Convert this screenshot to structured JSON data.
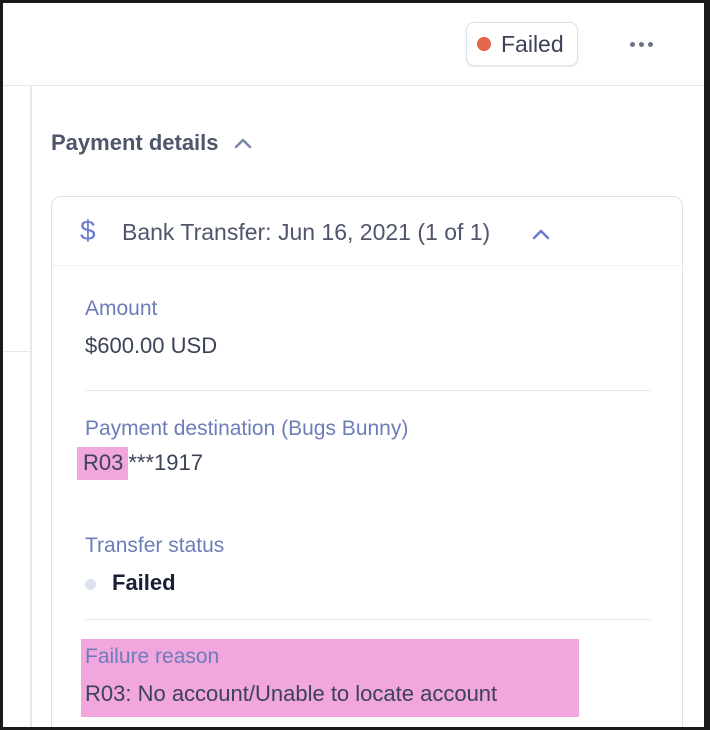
{
  "colors": {
    "failed_dot": "#e5664a",
    "accent": "#6c7dd1",
    "highlight": "#f1a6dd"
  },
  "header": {
    "status_label": "Failed",
    "more_icon": "ellipsis-icon"
  },
  "payment_details": {
    "title": "Payment details",
    "collapse_icon": "chevron-up-icon"
  },
  "transfer_card": {
    "icon": "dollar-icon",
    "title": "Bank Transfer: Jun 16, 2021 (1 of 1)",
    "collapse_icon": "chevron-up-icon",
    "amount": {
      "label": "Amount",
      "value": "$600.00 USD"
    },
    "destination": {
      "label": "Payment destination (Bugs Bunny)",
      "code": "R03",
      "account_mask": "***1917"
    },
    "transfer_status": {
      "label": "Transfer status",
      "value": "Failed"
    },
    "failure_reason": {
      "label": "Failure reason",
      "value": "R03: No account/Unable to locate account"
    }
  }
}
